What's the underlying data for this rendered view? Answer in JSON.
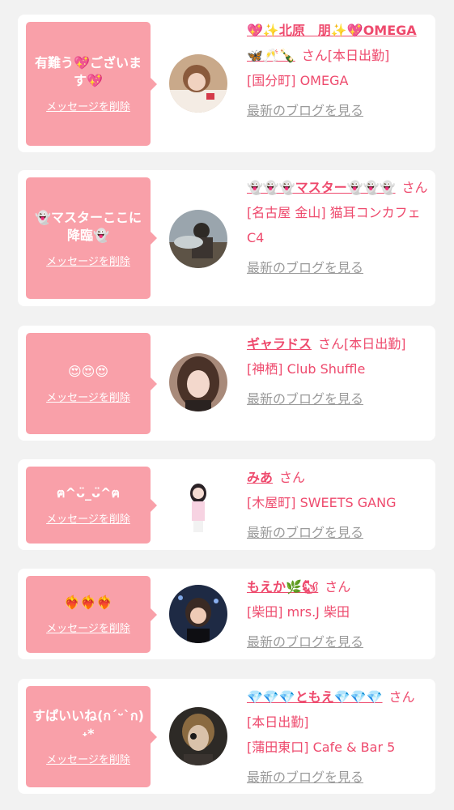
{
  "delete_label": "メッセージを削除",
  "blog_label": "最新のブログを見る",
  "san_label": "さん",
  "colors": {
    "accent": "#ee4a6d",
    "bubble": "#f9a0a9",
    "muted": "#9a9a9a"
  },
  "messages": [
    {
      "message": "有難う💖ございます💖",
      "name": "💖✨北原　朋✨💖OMEGA🦋🥂🍾",
      "status": "[本日出勤]",
      "shop": "[国分町] OMEGA"
    },
    {
      "message": "👻マスターここに降臨👻",
      "name": "👻👻👻マスター👻👻👻",
      "status": "",
      "shop": "[名古屋 金山] 猫耳コンカフェ C4"
    },
    {
      "message": "😍😍😍",
      "name": "ギャラドス",
      "status": "[本日出勤]",
      "shop": "[神栖] Club Shuffle"
    },
    {
      "message": "ฅ^ᴗ̈_ᴗ̈^ฅ",
      "name": "みあ",
      "status": "",
      "shop": "[木屋町] SWEETS GANG"
    },
    {
      "message": "❤️‍🔥❤️‍🔥❤️‍🔥",
      "name": "もえか🌿🐿",
      "status": "",
      "shop": "[柴田] mrs.J 柴田"
    },
    {
      "message": "すぱいいね(ก´ᵕ`ก)˖*",
      "name": "💎💎💎ともえ💎💎💎",
      "status": "[本日出勤]",
      "shop": "[蒲田東口] Cafe & Bar 5"
    }
  ]
}
